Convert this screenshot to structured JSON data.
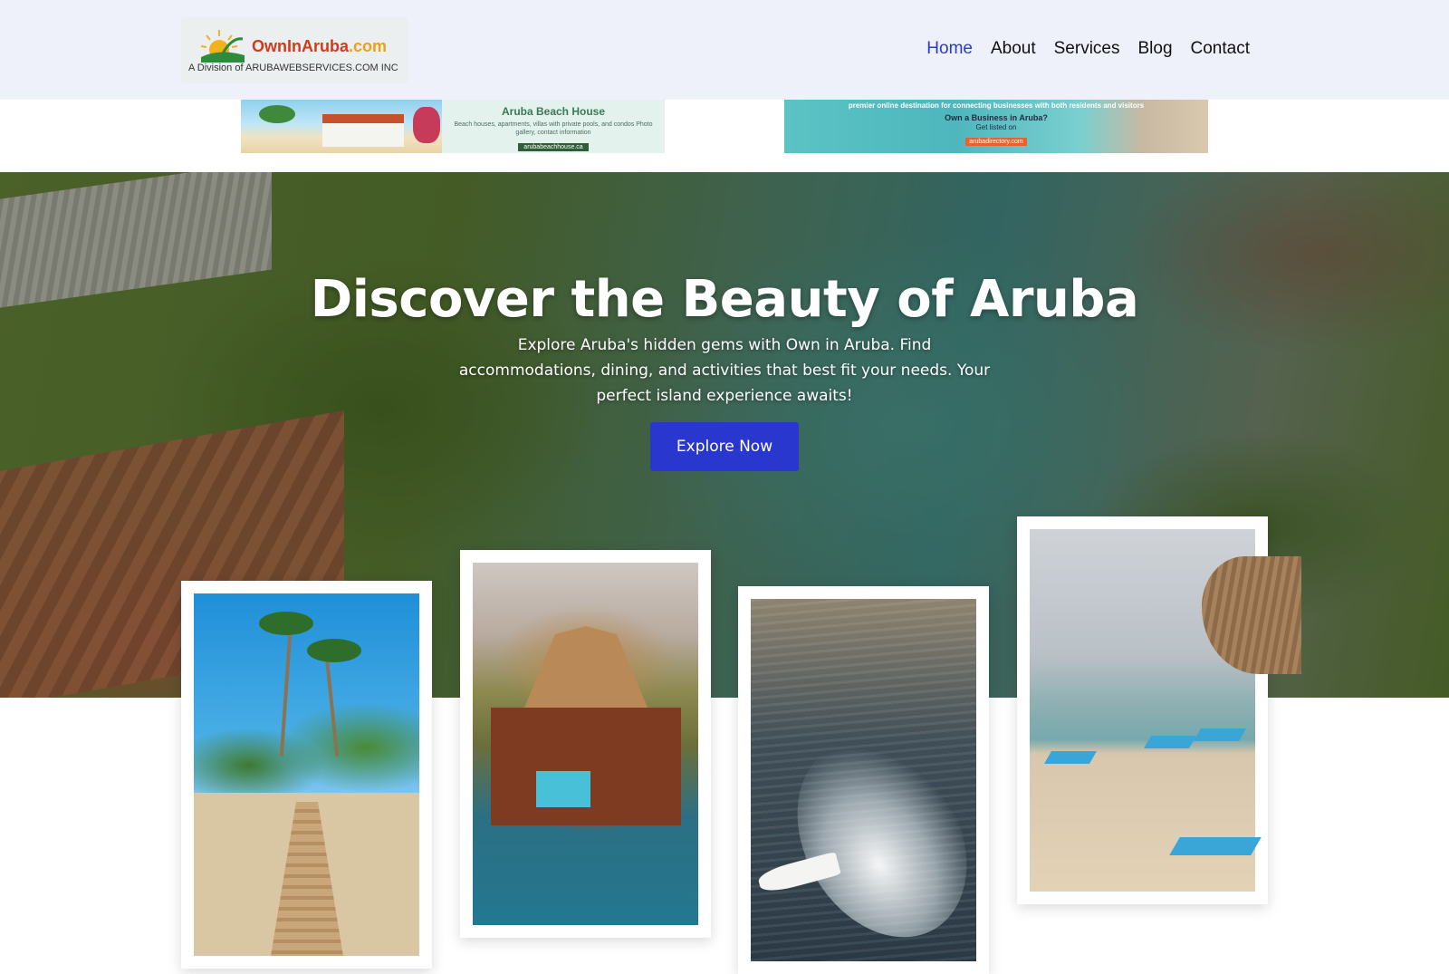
{
  "header": {
    "logo": {
      "name": "OwnInAruba",
      "tld": ".com",
      "subtitle": "A Division of ARUBAWEBSERVICES.COM INC"
    },
    "nav": [
      {
        "label": "Home",
        "active": true
      },
      {
        "label": "About",
        "active": false
      },
      {
        "label": "Services",
        "active": false
      },
      {
        "label": "Blog",
        "active": false
      },
      {
        "label": "Contact",
        "active": false
      }
    ],
    "accent_color": "#2b3bc4"
  },
  "ads": {
    "left": {
      "title": "Aruba Beach House",
      "description": "Beach houses, apartments, villas with private pools, and condos Photo gallery, contact information",
      "url": "arubabeachhouse.ca"
    },
    "right": {
      "line1": "premier online destination for connecting businesses with both residents and visitors",
      "line2": "Own a Business in Aruba?",
      "line3": "Get listed on",
      "url": "arubadirectory.com"
    }
  },
  "hero": {
    "title": "Discover the Beauty of Aruba",
    "description": "Explore Aruba's hidden gems with Own in Aruba. Find accommodations, dining, and activities that best fit your needs. Your perfect island experience awaits!",
    "button_label": "Explore Now",
    "button_color": "#2a37cf"
  },
  "gallery": [
    {
      "icon": "palm-beach-photo"
    },
    {
      "icon": "overwater-bungalow-photo"
    },
    {
      "icon": "speedboat-photo"
    },
    {
      "icon": "beach-umbrella-photo"
    }
  ]
}
